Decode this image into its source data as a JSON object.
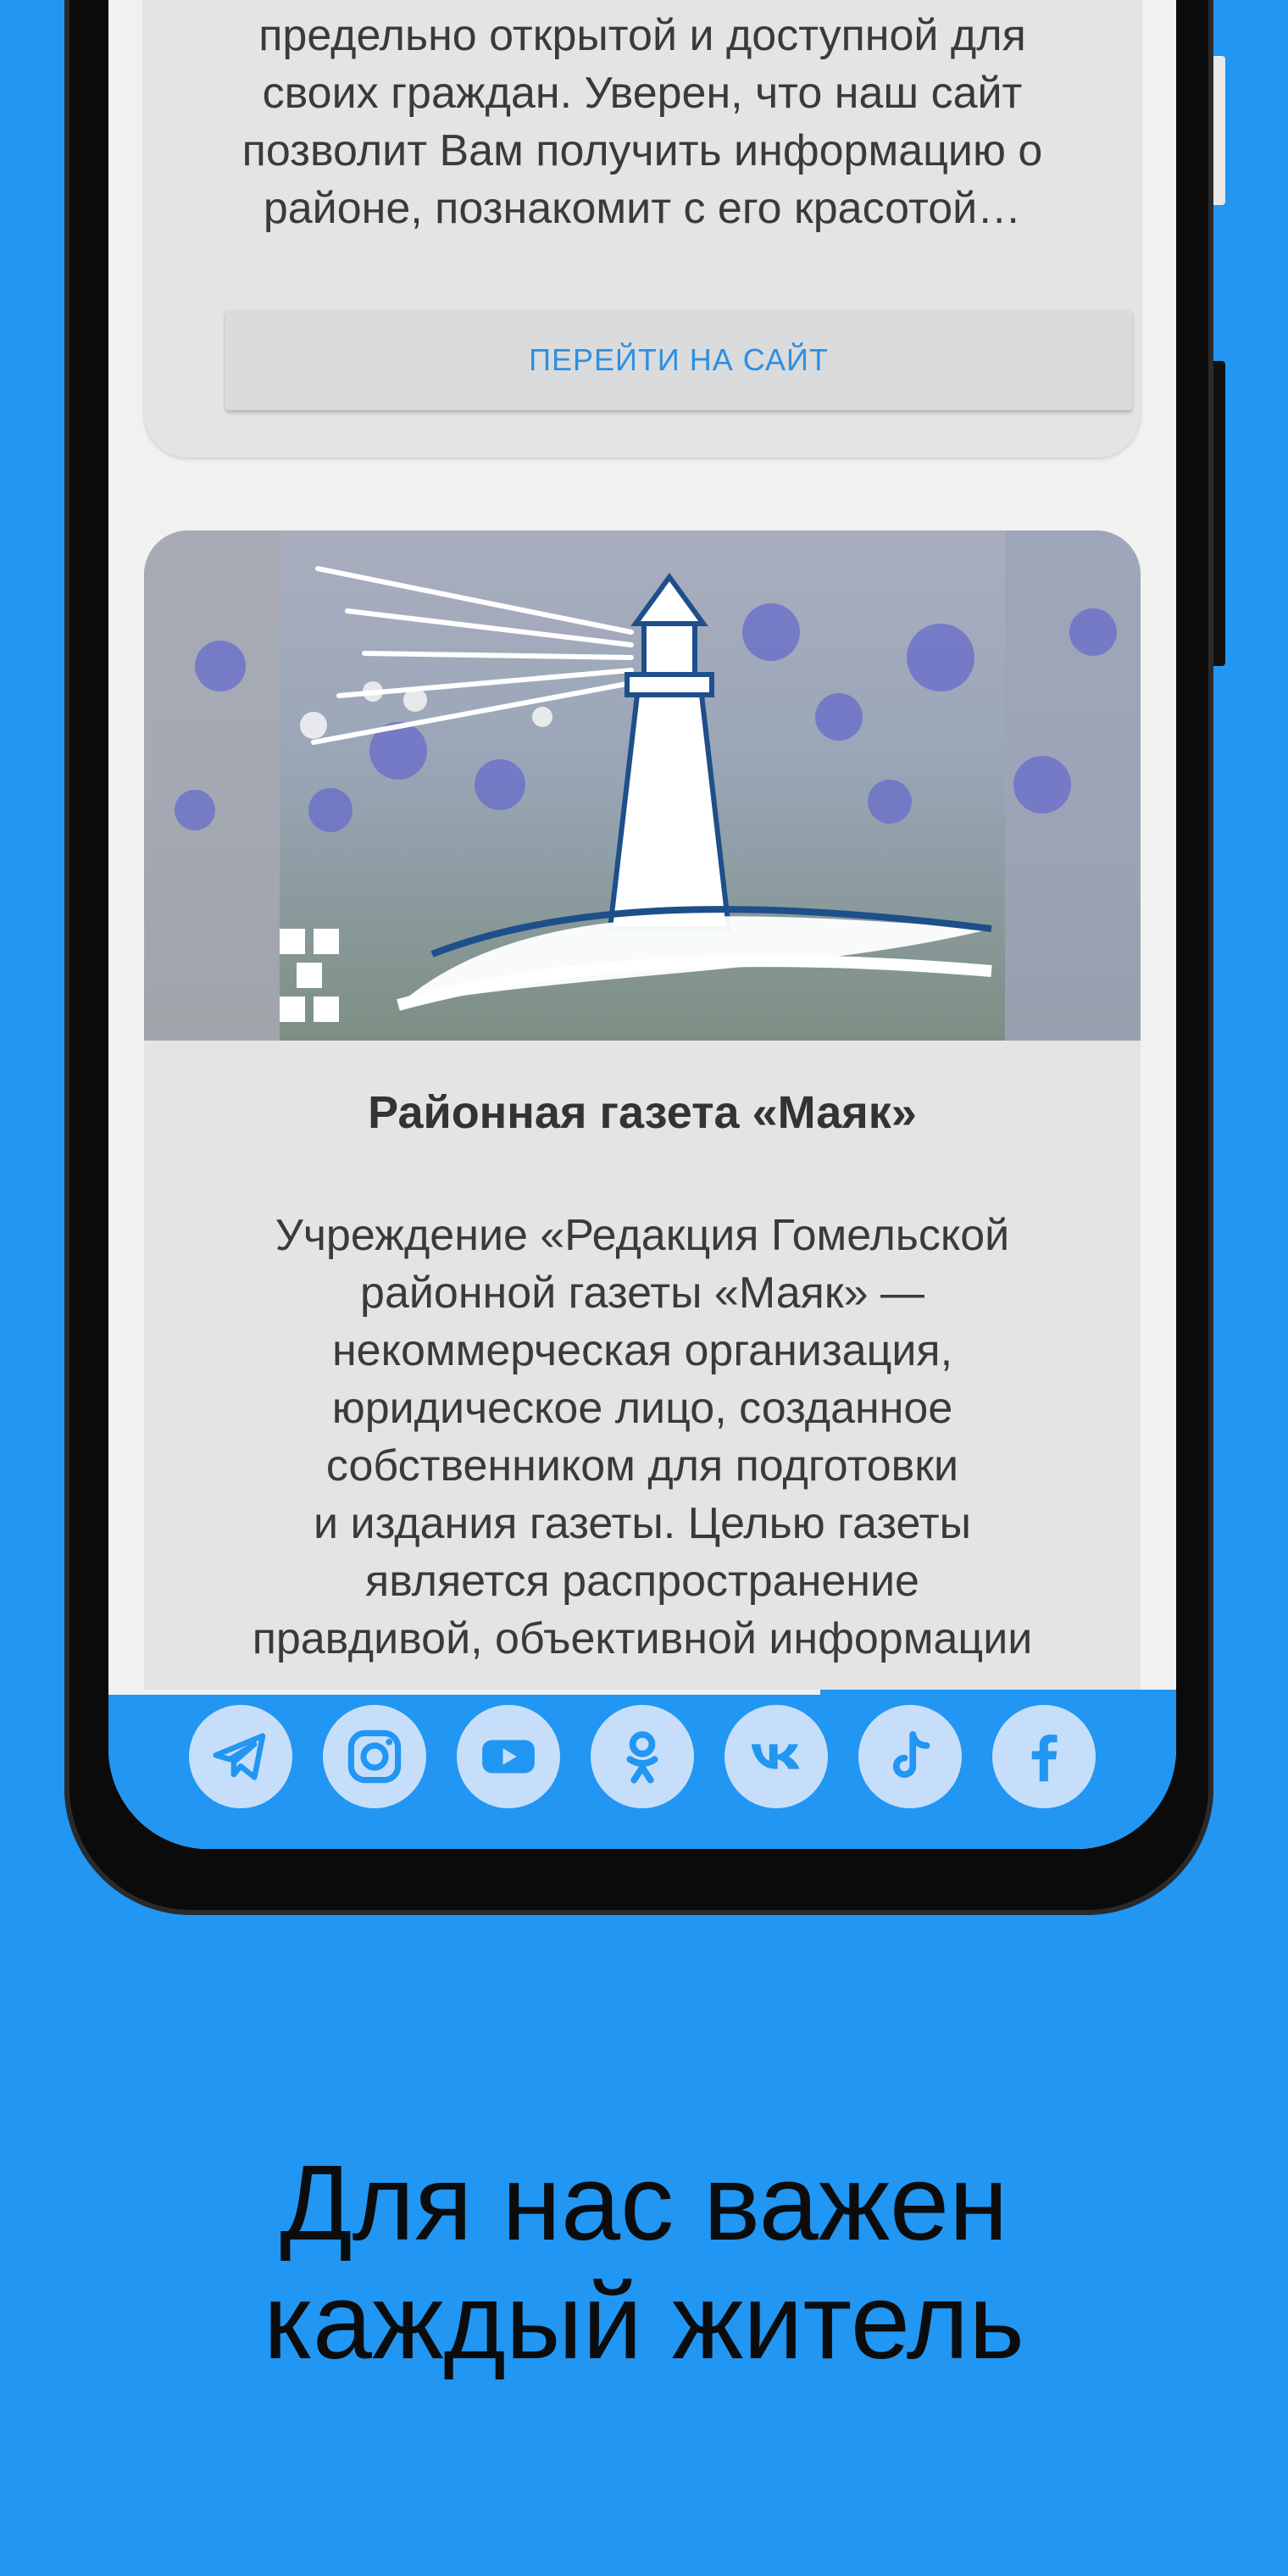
{
  "card1": {
    "text_lines": [
      "предельно открытой и доступной для",
      "своих граждан. Уверен, что наш сайт",
      "позволит Вам получить информацию о",
      "районе, познакомит с его красотой…"
    ],
    "button_label": "ПЕРЕЙТИ НА САЙТ"
  },
  "card2": {
    "title": "Районная газета «Маяк»",
    "description_lines": [
      "Учреждение «Редакция Гомельской",
      "районной газеты «Маяк» —",
      "некоммерческая организация,",
      "юридическое лицо, созданное",
      "собственником для подготовки",
      "и издания газеты. Целью газеты",
      "является распространение",
      "правдивой, объективной информации"
    ],
    "image_icon": "lighthouse-logo"
  },
  "social": {
    "icons": [
      "telegram-icon",
      "instagram-icon",
      "youtube-icon",
      "odnoklassniki-icon",
      "vk-icon",
      "tiktok-icon",
      "facebook-icon"
    ],
    "icon_bg": "#c7defa",
    "icon_fg": "#2196F3",
    "scroll_progress": 0.667
  },
  "headline_lines": [
    "Для нас важен",
    "каждый житель"
  ],
  "colors": {
    "accent": "#2196F3",
    "card_bg": "#e4e4e4",
    "screen_bg": "#f1f1f1"
  }
}
